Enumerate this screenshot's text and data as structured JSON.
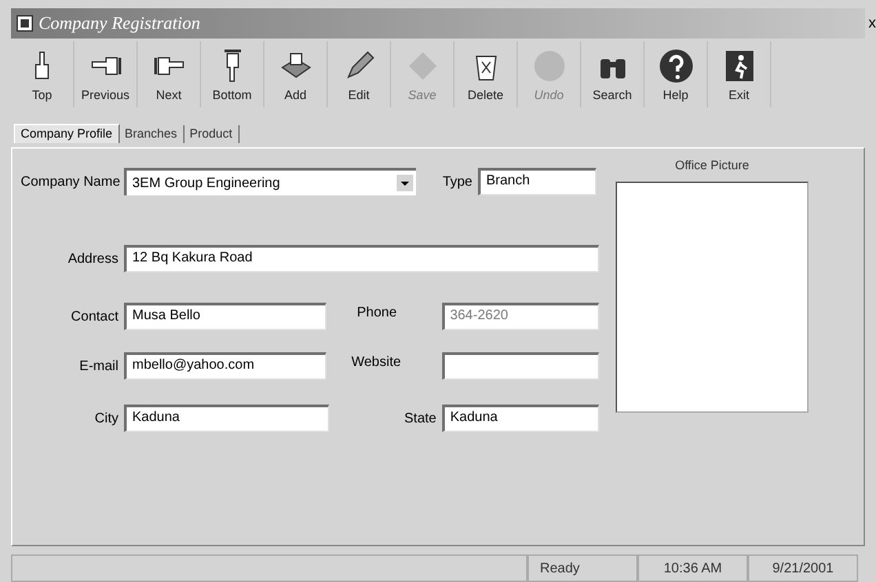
{
  "window": {
    "title": "Company Registration",
    "close": "x"
  },
  "toolbar": [
    {
      "label": "Top",
      "kind": "top",
      "disabled": false
    },
    {
      "label": "Previous",
      "kind": "previous",
      "disabled": false
    },
    {
      "label": "Next",
      "kind": "next",
      "disabled": false
    },
    {
      "label": "Bottom",
      "kind": "bottom",
      "disabled": false
    },
    {
      "label": "Add",
      "kind": "add",
      "disabled": false
    },
    {
      "label": "Edit",
      "kind": "edit",
      "disabled": false
    },
    {
      "label": "Save",
      "kind": "save",
      "disabled": true
    },
    {
      "label": "Delete",
      "kind": "delete",
      "disabled": false
    },
    {
      "label": "Undo",
      "kind": "undo",
      "disabled": true
    },
    {
      "label": "Search",
      "kind": "search",
      "disabled": false
    },
    {
      "label": "Help",
      "kind": "help",
      "disabled": false
    },
    {
      "label": "Exit",
      "kind": "exit",
      "disabled": false
    }
  ],
  "tabs": [
    {
      "label": "Company Profile",
      "selected": true
    },
    {
      "label": "Branches",
      "selected": false
    },
    {
      "label": "Product",
      "selected": false
    }
  ],
  "form": {
    "company_name": {
      "label": "Company Name",
      "value": "3EM Group Engineering"
    },
    "type": {
      "label": "Type",
      "value": "Branch"
    },
    "address": {
      "label": "Address",
      "value": "12 Bq Kakura Road"
    },
    "contact": {
      "label": "Contact",
      "value": "Musa Bello"
    },
    "phone": {
      "label": "Phone",
      "value": "364-2620",
      "disabled": true
    },
    "email": {
      "label": "E-mail",
      "value": "mbello@yahoo.com"
    },
    "website": {
      "label": "Website"
    },
    "city": {
      "label": "City",
      "value": "Kaduna"
    },
    "state": {
      "label": "State",
      "value": "Kaduna"
    },
    "office_picture": {
      "label": "Office Picture"
    }
  },
  "status_bar": [
    "Ready",
    "10:36 AM",
    "9/21/2001"
  ]
}
